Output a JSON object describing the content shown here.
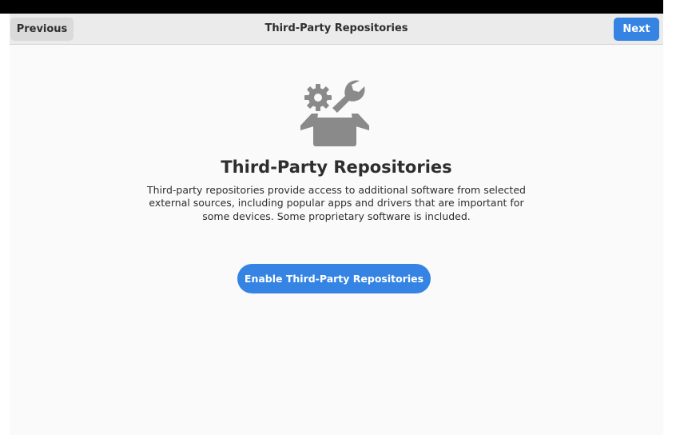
{
  "header": {
    "title": "Third-Party Repositories",
    "previous_label": "Previous",
    "next_label": "Next"
  },
  "main": {
    "icon": "tools-box-icon",
    "title": "Third-Party Repositories",
    "description": "Third-party repositories provide access to additional software from selected external sources, including popular apps and drivers that are important for some devices. Some proprietary software is included.",
    "enable_button_label": "Enable Third-Party Repositories"
  },
  "colors": {
    "accent": "#3584e4",
    "icon_gray": "#8a8a8a"
  }
}
